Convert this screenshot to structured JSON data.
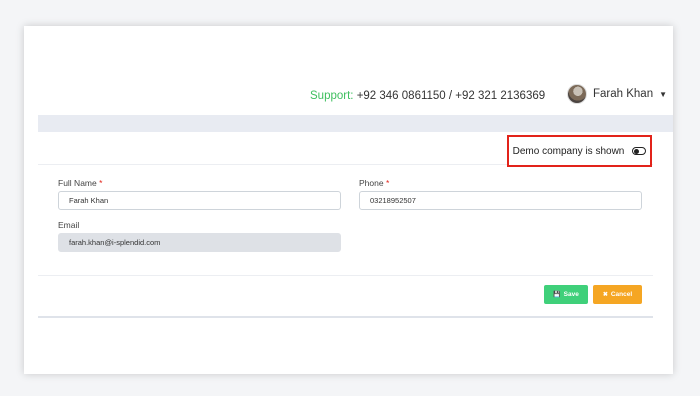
{
  "header": {
    "support_label": "Support:",
    "support_numbers": "+92 346 0861150 / +92 321 2136369",
    "user_name": "Farah Khan"
  },
  "demo": {
    "text": "Demo company is shown"
  },
  "form": {
    "full_name_label": "Full Name",
    "full_name_value": "Farah Khan",
    "phone_label": "Phone",
    "phone_value": "03218952507",
    "email_label": "Email",
    "email_value": "farah.khan@i-splendid.com",
    "required_mark": "*"
  },
  "actions": {
    "save_label": "Save",
    "cancel_label": "Cancel"
  },
  "colors": {
    "support_green": "#3fbf5f",
    "save_green": "#3fd07a",
    "cancel_orange": "#f5a623",
    "highlight_red": "#e2231a"
  }
}
